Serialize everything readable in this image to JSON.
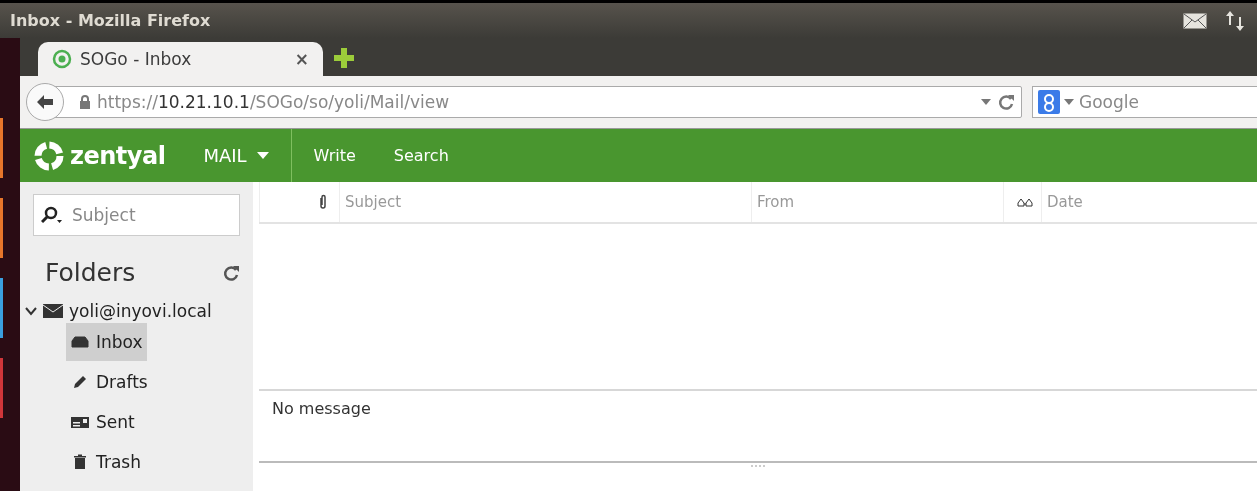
{
  "window": {
    "title": "Inbox - Mozilla Firefox"
  },
  "tabs": [
    {
      "label": "SOGo - Inbox",
      "selected": true,
      "close": "×"
    }
  ],
  "address_bar": {
    "url_host": "https://",
    "url_main": "10.21.10.1",
    "url_path": "/SOGo/so/yoli/Mail/view"
  },
  "search_bar": {
    "placeholder": "Google"
  },
  "app_bar": {
    "logo": "zentyal",
    "module": "MAIL",
    "links": [
      "Write",
      "Search"
    ]
  },
  "sidebar": {
    "search": {
      "placeholder": "Subject"
    },
    "heading": "Folders",
    "account": {
      "label": "yoli@inyovi.local",
      "expanded": true,
      "children": [
        {
          "label": "Inbox",
          "kind": "inbox",
          "selected": true
        },
        {
          "label": "Drafts",
          "kind": "drafts",
          "selected": false
        },
        {
          "label": "Sent",
          "kind": "sent",
          "selected": false
        },
        {
          "label": "Trash",
          "kind": "trash",
          "selected": false
        }
      ]
    }
  },
  "table": {
    "columns": [
      {
        "kind": "attachment"
      },
      {
        "label": "Subject",
        "kind": "text"
      },
      {
        "label": "From",
        "kind": "text"
      },
      {
        "kind": "read"
      },
      {
        "label": "Date",
        "kind": "text"
      }
    ]
  },
  "preview": {
    "text": "No message"
  }
}
